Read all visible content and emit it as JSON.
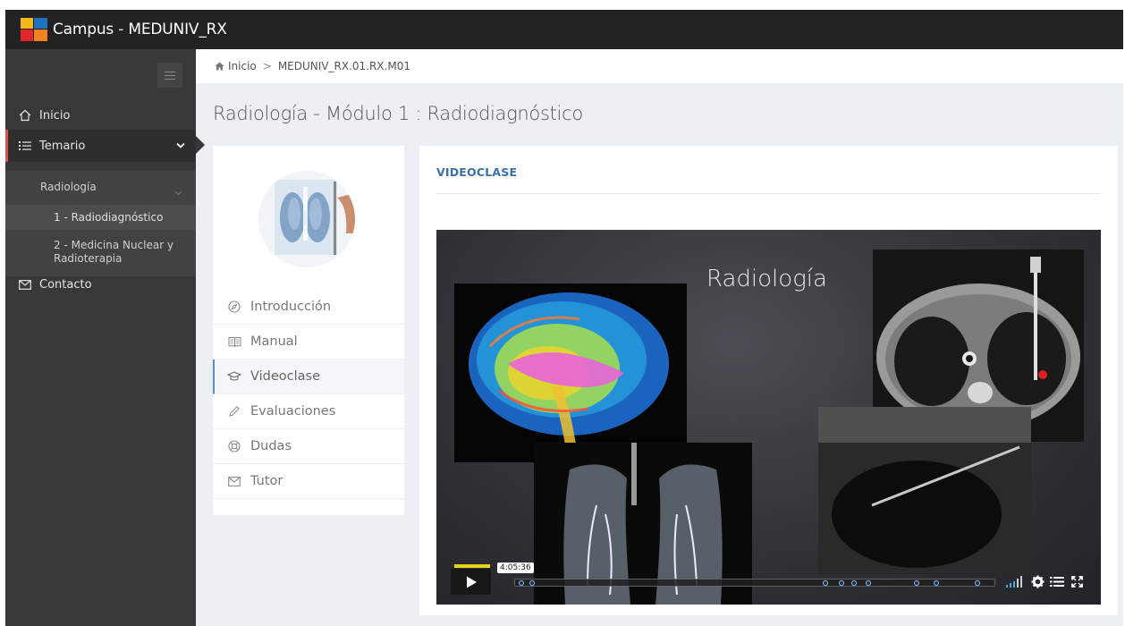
{
  "app": {
    "title": "Campus - MEDUNIV_RX"
  },
  "sidebar": {
    "items": [
      {
        "label": "Inicio",
        "icon": "home-icon"
      },
      {
        "label": "Temario",
        "icon": "list-icon"
      },
      {
        "label": "Contacto",
        "icon": "mail-icon"
      }
    ],
    "subgroup": {
      "label": "Radiología",
      "items": [
        {
          "label": "1 - Radiodiagnóstico"
        },
        {
          "label_line1": "2 - Medicina Nuclear y",
          "label_line2": "Radioterapia"
        }
      ]
    }
  },
  "breadcrumb": {
    "home": "Inicio",
    "current": "MEDUNIV_RX.01.RX.M01"
  },
  "page": {
    "title": "Radiología - Módulo 1 : Radiodiagnóstico"
  },
  "module_menu": {
    "items": [
      {
        "label": "Introducción",
        "icon": "compass-icon"
      },
      {
        "label": "Manual",
        "icon": "book-icon"
      },
      {
        "label": "Videoclase",
        "icon": "graduation-cap-icon"
      },
      {
        "label": "Evaluaciones",
        "icon": "pencil-icon"
      },
      {
        "label": "Dudas",
        "icon": "lifebuoy-icon"
      },
      {
        "label": "Tutor",
        "icon": "envelope-icon"
      }
    ],
    "active": "Videoclase"
  },
  "content": {
    "section_title": "VIDEOCLASE",
    "video": {
      "slide_title": "Radiología",
      "hover_time": "4:05:36"
    }
  },
  "colors": {
    "topbar": "#222222",
    "sidebar": "#383838",
    "accent_red": "#d9534f",
    "link_blue": "#3a6fa8"
  }
}
